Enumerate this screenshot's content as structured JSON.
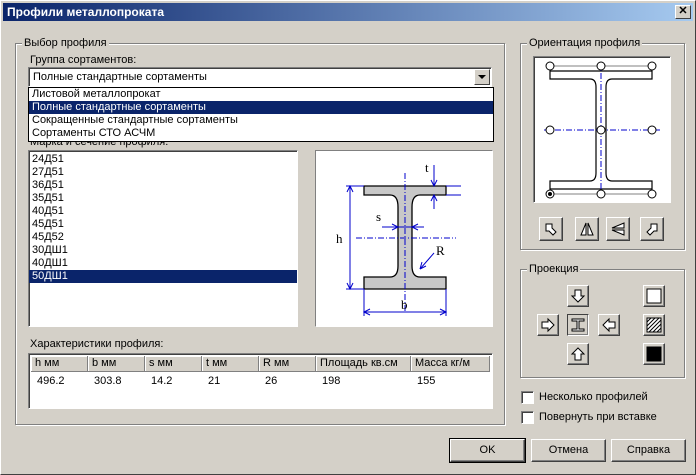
{
  "window": {
    "title": "Профили металлопроката",
    "close_label": "✕"
  },
  "profile_group": {
    "title": "Выбор профиля",
    "assortment_label": "Группа сортаментов:",
    "assortment_value": "Полные стандартные сортаменты",
    "dropdown_options": [
      "Листовой металлопрокат",
      "Полные стандартные сортаменты",
      "Сокращенные стандартные сортаменты",
      "Сортаменты СТО АСЧМ"
    ],
    "section_label_partial": "Марка и сечение профиля:",
    "sections": [
      "24Д51",
      "27Д51",
      "36Д51",
      "35Д51",
      "40Д51",
      "45Д51",
      "45Д52",
      "30ДШ1",
      "40ДШ1",
      "50ДШ1"
    ],
    "selected_section": "50ДШ1"
  },
  "drawing": {
    "label_t": "t",
    "label_s": "s",
    "label_h": "h",
    "label_R": "R",
    "label_b": "b"
  },
  "characteristics": {
    "title": "Характеристики профиля:",
    "headers": [
      "h мм",
      "b мм",
      "s мм",
      "t мм",
      "R мм",
      "Площадь кв.см",
      "Масса кг/м"
    ],
    "values": [
      "496.2",
      "303.8",
      "14.2",
      "21",
      "26",
      "198",
      "155"
    ]
  },
  "orientation": {
    "title": "Ориентация профиля"
  },
  "projection": {
    "title": "Проекция"
  },
  "options": {
    "multiple_profiles": "Несколько профилей",
    "rotate_on_insert": "Повернуть при вставке"
  },
  "buttons": {
    "ok": "OK",
    "cancel": "Отмена",
    "help": "Справка"
  }
}
